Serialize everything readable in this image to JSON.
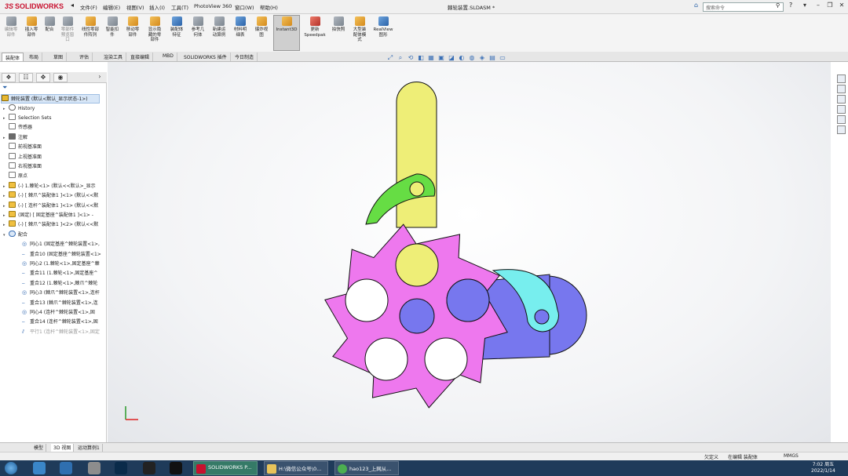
{
  "app": {
    "logo_prefix": "3S",
    "logo_name": "SOLIDWORKS",
    "doc_title": "棘轮装置.SLDASM *"
  },
  "menu": [
    "文件(F)",
    "编辑(E)",
    "视图(V)",
    "插入(I)",
    "工具(T)",
    "PhotoView 360",
    "窗口(W)",
    "帮助(H)"
  ],
  "search": {
    "placeholder": "搜索命令"
  },
  "toolbar": [
    {
      "label": "编辑零\n部件",
      "icon": "edit-component-icon"
    },
    {
      "label": "插入零\n部件",
      "icon": "insert-component-icon"
    },
    {
      "label": "配合",
      "icon": "mate-icon"
    },
    {
      "label": "零部件\n预览窗\n口",
      "icon": "preview-window-icon"
    },
    {
      "label": "线性零部\n件阵列",
      "icon": "linear-pattern-icon"
    },
    {
      "label": "智能扣\n件",
      "icon": "smart-fastener-icon"
    },
    {
      "label": "移动零\n部件",
      "icon": "move-component-icon"
    },
    {
      "label": "显示隐\n藏的零\n部件",
      "icon": "show-hidden-icon"
    },
    {
      "label": "装配体\n特征",
      "icon": "assembly-feature-icon"
    },
    {
      "label": "参考几\n何体",
      "icon": "reference-geometry-icon"
    },
    {
      "label": "新建运\n动算例",
      "icon": "motion-study-icon"
    },
    {
      "label": "材料明\n细表",
      "icon": "bom-icon"
    },
    {
      "label": "爆炸视\n图",
      "icon": "explode-view-icon"
    },
    {
      "label": "Instant3D",
      "icon": "instant3d-icon"
    },
    {
      "label": "更新\nSpeedpak",
      "icon": "speedpak-icon"
    },
    {
      "label": "拍快照",
      "icon": "snapshot-icon"
    },
    {
      "label": "大型装\n配体模\n式",
      "icon": "large-assembly-icon"
    },
    {
      "label": "RealView\n图形",
      "icon": "realview-icon"
    }
  ],
  "tabs": [
    "装配体",
    "布局",
    "草图",
    "评估",
    "渲染工具",
    "直接编辑",
    "MBD",
    "SOLIDWORKS 插件",
    "今日制造"
  ],
  "active_tab": "装配体",
  "tree": {
    "root": "棘轮装置 (默认<默认_显示状态-1>)",
    "items": [
      {
        "label": "History",
        "icon": "history-icon",
        "expand": true
      },
      {
        "label": "Selection Sets",
        "icon": "selection-sets-icon",
        "expand": true
      },
      {
        "label": "传感器",
        "icon": "sensor-icon",
        "expand": false
      },
      {
        "label": "注解",
        "icon": "annotation-icon",
        "expand": true
      },
      {
        "label": "前视基准面",
        "icon": "plane-icon",
        "expand": false
      },
      {
        "label": "上视基准面",
        "icon": "plane-icon",
        "expand": false
      },
      {
        "label": "右视基准面",
        "icon": "plane-icon",
        "expand": false
      },
      {
        "label": "原点",
        "icon": "origin-icon",
        "expand": false
      },
      {
        "label": "(-) 1.棘轮<1> (默认<<默认>_显示",
        "icon": "part-icon",
        "expand": true
      },
      {
        "label": "(-) [ 棘爪^装配体1 ]<1> (默认<<默",
        "icon": "part-icon",
        "expand": true
      },
      {
        "label": "(-) [ 连杆^装配体1 ]<1> (默认<<默",
        "icon": "part-icon",
        "expand": true
      },
      {
        "label": "(固定) [ 固定基座^装配体1 ]<1> -",
        "icon": "part-icon",
        "expand": true
      },
      {
        "label": "(-) [ 棘爪^装配体1 ]<2> (默认<<默",
        "icon": "part-icon",
        "expand": true
      },
      {
        "label": "配合",
        "icon": "mates-folder-icon",
        "expand": true
      }
    ],
    "mates": [
      "同心1 (固定基座^棘轮装置<1>,",
      "重合10 (固定基座^棘轮装置<1>",
      "同心2 (1.棘轮<1>,固定基座^棘",
      "重合11 (1.棘轮<1>,固定基座^",
      "重合12 (1.棘轮<1>,棘爪^棘轮",
      "同心3 (棘爪^棘轮装置<1>,连杆",
      "重合13 (棘爪^棘轮装置<1>,连",
      "同心4 (连杆^棘轮装置<1>,固",
      "重合14 (连杆^棘轮装置<1>,固",
      "平行1 (连杆^棘轮装置<1>,固定"
    ]
  },
  "bottom_tabs": [
    "模型",
    "3D 视图",
    "运动算例1"
  ],
  "status": {
    "left": "",
    "mode": "欠定义",
    "editing": "在编辑 装配体",
    "units": "MMGS"
  },
  "taskbar": {
    "items": [
      "SOLIDWORKS P...",
      "H:\\微信公众号\\0...",
      "hao123_上网从..."
    ],
    "time": "7:02 周五",
    "date": "2022/1/14"
  },
  "colors": {
    "ratchet": "#ee78ee",
    "pawl_upper": "#66dd44",
    "pawl_lower": "#77eeee",
    "link": "#eeee77",
    "base": "#7777ee",
    "holes": "#ffffff",
    "accent": "#2a62a8"
  }
}
